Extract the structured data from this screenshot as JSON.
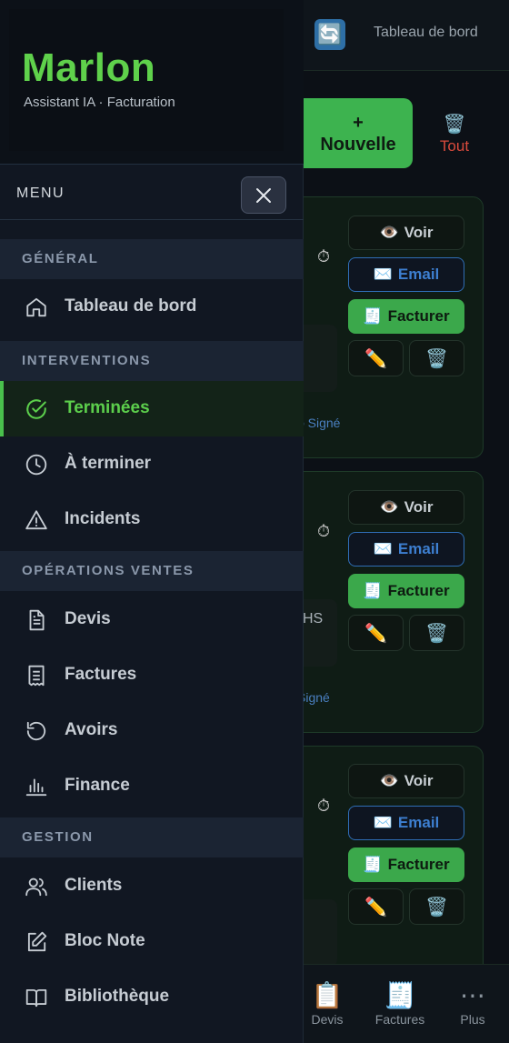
{
  "topbar": {
    "title": "Tableau de bord",
    "sync_icon": "🔄"
  },
  "actions": {
    "new_plus": "+",
    "new_label": "Nouvelle",
    "all_icon": "🗑️",
    "all_label": "Tout"
  },
  "cards": [
    {
      "view": "Voir",
      "email": "Email",
      "bill": "Facturer",
      "signed": "Signé",
      "note": ""
    },
    {
      "view": "Voir",
      "email": "Email",
      "bill": "Facturer",
      "signed": "Signé",
      "note": "HS"
    },
    {
      "view": "Voir",
      "email": "Email",
      "bill": "Facturer"
    }
  ],
  "bottom_nav": [
    {
      "icon": "📋",
      "label": "Devis"
    },
    {
      "icon": "🧾",
      "label": "Factures"
    },
    {
      "icon": "⋯",
      "label": "Plus"
    }
  ],
  "drawer": {
    "brand": "Marlon",
    "subtitle": "Assistant IA · Facturation",
    "menu_title": "MENU",
    "sections": {
      "general": "GÉNÉRAL",
      "interventions": "INTERVENTIONS",
      "sales": "OPÉRATIONS VENTES",
      "management": "GESTION"
    },
    "items": {
      "dashboard": "Tableau de bord",
      "done": "Terminées",
      "todo": "À terminer",
      "incidents": "Incidents",
      "quotes": "Devis",
      "invoices": "Factures",
      "credits": "Avoirs",
      "finance": "Finance",
      "clients": "Clients",
      "notes": "Bloc Note",
      "library": "Bibliothèque"
    }
  },
  "colors": {
    "accent": "#5fd14b",
    "active_bg": "#132318",
    "section_bg": "#1b2433",
    "danger": "#d84a3c",
    "email": "#3d7fd0"
  }
}
